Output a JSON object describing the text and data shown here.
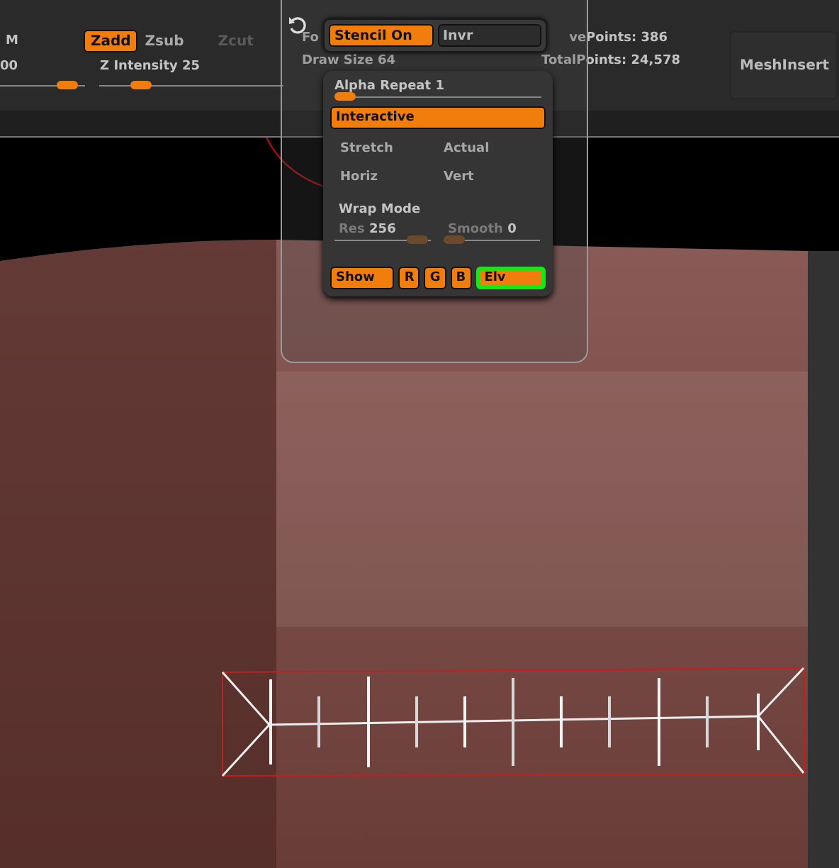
{
  "toolbar": {
    "m_label": "M",
    "left_value": "00",
    "sculpt_modes": [
      {
        "label": "Zadd",
        "selected": true,
        "disabled": false
      },
      {
        "label": "Zsub",
        "selected": false,
        "disabled": false
      },
      {
        "label": "Zcut",
        "selected": false,
        "disabled": true
      }
    ],
    "rgb_slider": {
      "level": 0.78
    },
    "z_intensity": {
      "label": "Z Intensity 25",
      "level": 0.22
    },
    "cut_label": "Fo",
    "draw_size": "Draw Size 64",
    "active_points": "vePoints: 386",
    "total_points": "TotalPoints: 24,578",
    "mesh_insert": "MeshInsert"
  },
  "stencil_bar": [
    {
      "label": "Stencil On",
      "selected": true
    },
    {
      "label": "Invr",
      "selected": false
    }
  ],
  "alpha_popup": {
    "repeat": {
      "label": "Alpha Repeat 1",
      "level": 0.05
    },
    "modes": [
      {
        "label": "Interactive",
        "selected": true
      },
      {
        "label": "Stretch",
        "selected": false
      },
      {
        "label": "Actual",
        "selected": false
      },
      {
        "label": "Horiz",
        "selected": false
      },
      {
        "label": "Vert",
        "selected": false
      }
    ],
    "wrap_mode": "Wrap Mode",
    "sliders": [
      {
        "label": "Res",
        "value": "256",
        "disabled": true,
        "level": 0.85
      },
      {
        "label": "Smooth",
        "value": "0",
        "disabled": true,
        "level": 0.05
      }
    ],
    "channels": [
      {
        "label": "Show",
        "on": true,
        "highlighted": false
      },
      {
        "label": "R",
        "on": true,
        "highlighted": false
      },
      {
        "label": "G",
        "on": true,
        "highlighted": false
      },
      {
        "label": "B",
        "on": true,
        "highlighted": false
      },
      {
        "label": "Elv",
        "on": true,
        "highlighted": true
      }
    ]
  }
}
